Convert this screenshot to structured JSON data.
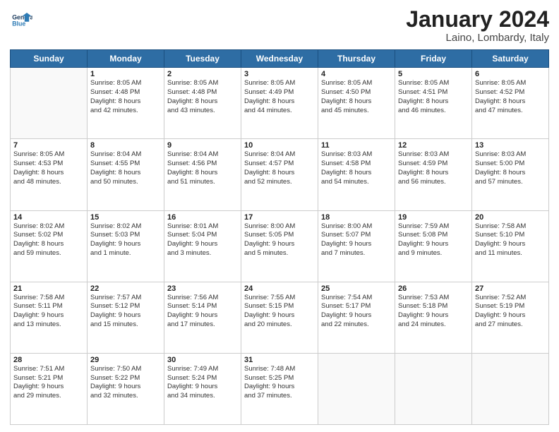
{
  "header": {
    "logo_line1": "General",
    "logo_line2": "Blue",
    "month": "January 2024",
    "location": "Laino, Lombardy, Italy"
  },
  "weekdays": [
    "Sunday",
    "Monday",
    "Tuesday",
    "Wednesday",
    "Thursday",
    "Friday",
    "Saturday"
  ],
  "weeks": [
    [
      {
        "day": "",
        "info": ""
      },
      {
        "day": "1",
        "info": "Sunrise: 8:05 AM\nSunset: 4:48 PM\nDaylight: 8 hours\nand 42 minutes."
      },
      {
        "day": "2",
        "info": "Sunrise: 8:05 AM\nSunset: 4:48 PM\nDaylight: 8 hours\nand 43 minutes."
      },
      {
        "day": "3",
        "info": "Sunrise: 8:05 AM\nSunset: 4:49 PM\nDaylight: 8 hours\nand 44 minutes."
      },
      {
        "day": "4",
        "info": "Sunrise: 8:05 AM\nSunset: 4:50 PM\nDaylight: 8 hours\nand 45 minutes."
      },
      {
        "day": "5",
        "info": "Sunrise: 8:05 AM\nSunset: 4:51 PM\nDaylight: 8 hours\nand 46 minutes."
      },
      {
        "day": "6",
        "info": "Sunrise: 8:05 AM\nSunset: 4:52 PM\nDaylight: 8 hours\nand 47 minutes."
      }
    ],
    [
      {
        "day": "7",
        "info": "Sunrise: 8:05 AM\nSunset: 4:53 PM\nDaylight: 8 hours\nand 48 minutes."
      },
      {
        "day": "8",
        "info": "Sunrise: 8:04 AM\nSunset: 4:55 PM\nDaylight: 8 hours\nand 50 minutes."
      },
      {
        "day": "9",
        "info": "Sunrise: 8:04 AM\nSunset: 4:56 PM\nDaylight: 8 hours\nand 51 minutes."
      },
      {
        "day": "10",
        "info": "Sunrise: 8:04 AM\nSunset: 4:57 PM\nDaylight: 8 hours\nand 52 minutes."
      },
      {
        "day": "11",
        "info": "Sunrise: 8:03 AM\nSunset: 4:58 PM\nDaylight: 8 hours\nand 54 minutes."
      },
      {
        "day": "12",
        "info": "Sunrise: 8:03 AM\nSunset: 4:59 PM\nDaylight: 8 hours\nand 56 minutes."
      },
      {
        "day": "13",
        "info": "Sunrise: 8:03 AM\nSunset: 5:00 PM\nDaylight: 8 hours\nand 57 minutes."
      }
    ],
    [
      {
        "day": "14",
        "info": "Sunrise: 8:02 AM\nSunset: 5:02 PM\nDaylight: 8 hours\nand 59 minutes."
      },
      {
        "day": "15",
        "info": "Sunrise: 8:02 AM\nSunset: 5:03 PM\nDaylight: 9 hours\nand 1 minute."
      },
      {
        "day": "16",
        "info": "Sunrise: 8:01 AM\nSunset: 5:04 PM\nDaylight: 9 hours\nand 3 minutes."
      },
      {
        "day": "17",
        "info": "Sunrise: 8:00 AM\nSunset: 5:05 PM\nDaylight: 9 hours\nand 5 minutes."
      },
      {
        "day": "18",
        "info": "Sunrise: 8:00 AM\nSunset: 5:07 PM\nDaylight: 9 hours\nand 7 minutes."
      },
      {
        "day": "19",
        "info": "Sunrise: 7:59 AM\nSunset: 5:08 PM\nDaylight: 9 hours\nand 9 minutes."
      },
      {
        "day": "20",
        "info": "Sunrise: 7:58 AM\nSunset: 5:10 PM\nDaylight: 9 hours\nand 11 minutes."
      }
    ],
    [
      {
        "day": "21",
        "info": "Sunrise: 7:58 AM\nSunset: 5:11 PM\nDaylight: 9 hours\nand 13 minutes."
      },
      {
        "day": "22",
        "info": "Sunrise: 7:57 AM\nSunset: 5:12 PM\nDaylight: 9 hours\nand 15 minutes."
      },
      {
        "day": "23",
        "info": "Sunrise: 7:56 AM\nSunset: 5:14 PM\nDaylight: 9 hours\nand 17 minutes."
      },
      {
        "day": "24",
        "info": "Sunrise: 7:55 AM\nSunset: 5:15 PM\nDaylight: 9 hours\nand 20 minutes."
      },
      {
        "day": "25",
        "info": "Sunrise: 7:54 AM\nSunset: 5:17 PM\nDaylight: 9 hours\nand 22 minutes."
      },
      {
        "day": "26",
        "info": "Sunrise: 7:53 AM\nSunset: 5:18 PM\nDaylight: 9 hours\nand 24 minutes."
      },
      {
        "day": "27",
        "info": "Sunrise: 7:52 AM\nSunset: 5:19 PM\nDaylight: 9 hours\nand 27 minutes."
      }
    ],
    [
      {
        "day": "28",
        "info": "Sunrise: 7:51 AM\nSunset: 5:21 PM\nDaylight: 9 hours\nand 29 minutes."
      },
      {
        "day": "29",
        "info": "Sunrise: 7:50 AM\nSunset: 5:22 PM\nDaylight: 9 hours\nand 32 minutes."
      },
      {
        "day": "30",
        "info": "Sunrise: 7:49 AM\nSunset: 5:24 PM\nDaylight: 9 hours\nand 34 minutes."
      },
      {
        "day": "31",
        "info": "Sunrise: 7:48 AM\nSunset: 5:25 PM\nDaylight: 9 hours\nand 37 minutes."
      },
      {
        "day": "",
        "info": ""
      },
      {
        "day": "",
        "info": ""
      },
      {
        "day": "",
        "info": ""
      }
    ]
  ]
}
